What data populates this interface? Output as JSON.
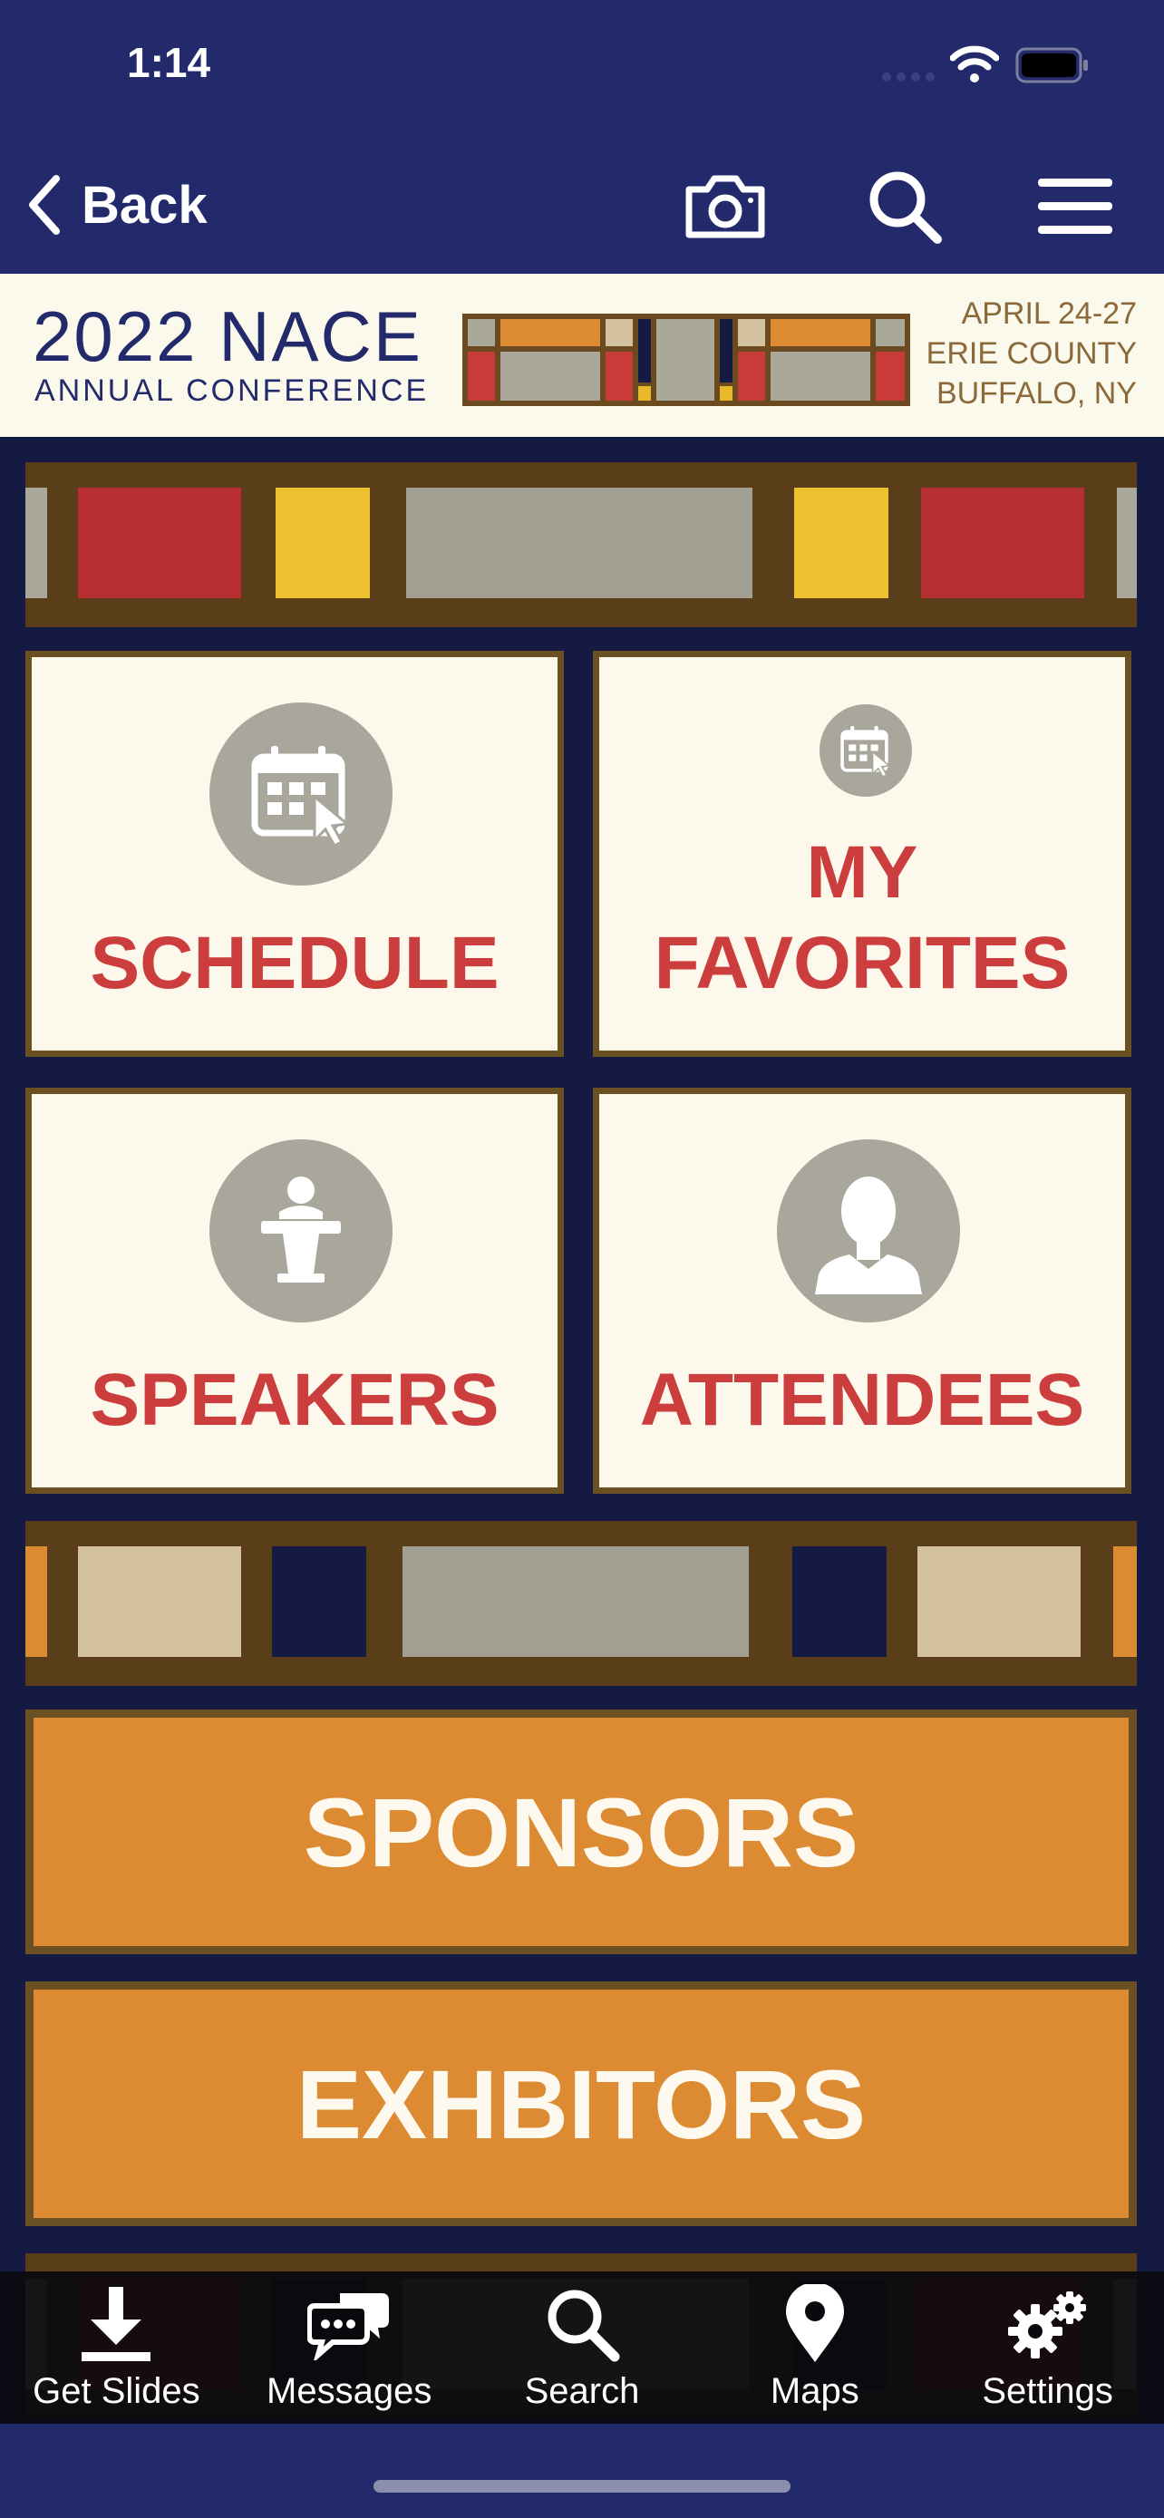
{
  "status_bar": {
    "time": "1:14"
  },
  "nav_bar": {
    "back_label": "Back",
    "actions": [
      {
        "name": "camera",
        "icon": "camera-icon"
      },
      {
        "name": "search",
        "icon": "search-icon"
      },
      {
        "name": "menu",
        "icon": "hamburger-menu-icon"
      }
    ]
  },
  "banner": {
    "title": "2022 NACE",
    "subtitle": "ANNUAL CONFERENCE",
    "date_line": "APRIL 24-27",
    "location_line1": "ERIE COUNTY",
    "location_line2": "BUFFALO, NY"
  },
  "tiles": {
    "schedule": {
      "label": "SCHEDULE",
      "icon": "calendar-icon"
    },
    "favorites": {
      "label_line1": "MY",
      "label_line2": "FAVORITES",
      "icon": "calendar-icon"
    },
    "speakers": {
      "label": "SPEAKERS",
      "icon": "podium-speaker-icon"
    },
    "attendees": {
      "label": "ATTENDEES",
      "icon": "person-silhouette-icon"
    }
  },
  "buttons": {
    "sponsors": "SPONSORS",
    "exhibitors": "EXHBITORS"
  },
  "tab_bar": {
    "items": [
      {
        "label": "Get Slides",
        "icon": "download-icon"
      },
      {
        "label": "Messages",
        "icon": "chat-bubbles-icon"
      },
      {
        "label": "Search",
        "icon": "search-icon"
      },
      {
        "label": "Maps",
        "icon": "map-pin-icon"
      },
      {
        "label": "Settings",
        "icon": "gears-icon"
      }
    ]
  },
  "colors": {
    "navy": "#232a6b",
    "tile_text_red": "#cc3e3e",
    "orange": "#dd8b33",
    "brown_border": "#6a5023",
    "cream": "#fcf9ec"
  }
}
